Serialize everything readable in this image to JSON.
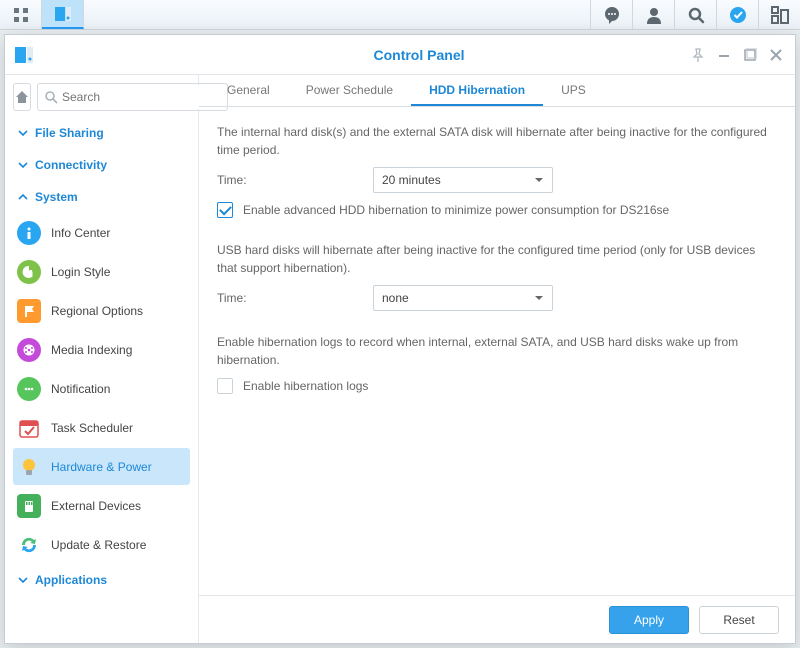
{
  "taskbar": {
    "icons_left": [
      "grid",
      "cp"
    ],
    "icons_right": [
      "chat",
      "user",
      "search",
      "check",
      "dash"
    ]
  },
  "window": {
    "title": "Control Panel",
    "search_placeholder": "Search"
  },
  "sidebar": {
    "sections": [
      {
        "label": "File Sharing",
        "open": false
      },
      {
        "label": "Connectivity",
        "open": false
      },
      {
        "label": "System",
        "open": true
      },
      {
        "label": "Applications",
        "open": false
      }
    ],
    "system_items": [
      {
        "label": "Info Center",
        "icon": "info",
        "bg": "#2aa5f0"
      },
      {
        "label": "Login Style",
        "icon": "palette",
        "bg": "#7fc24a"
      },
      {
        "label": "Regional Options",
        "icon": "flag",
        "bg": "#ff9a2e"
      },
      {
        "label": "Media Indexing",
        "icon": "film",
        "bg": "#c44bd9"
      },
      {
        "label": "Notification",
        "icon": "dots",
        "bg": "#56c55b"
      },
      {
        "label": "Task Scheduler",
        "icon": "cal",
        "bg": "#ffffff"
      },
      {
        "label": "Hardware & Power",
        "icon": "bulb",
        "bg": "#ffffff",
        "active": true
      },
      {
        "label": "External Devices",
        "icon": "sd",
        "bg": "#44b05c"
      },
      {
        "label": "Update & Restore",
        "icon": "sync",
        "bg": "#ffffff"
      }
    ]
  },
  "tabs": [
    {
      "label": "General"
    },
    {
      "label": "Power Schedule"
    },
    {
      "label": "HDD Hibernation",
      "active": true
    },
    {
      "label": "UPS"
    }
  ],
  "panel": {
    "internal_desc": "The internal hard disk(s) and the external SATA disk will hibernate after being inactive for the configured time period.",
    "time_label": "Time:",
    "internal_time_value": "20 minutes",
    "adv_label": "Enable advanced HDD hibernation to minimize power consumption for DS216se",
    "usb_desc": "USB hard disks will hibernate after being inactive for the configured time period (only for USB devices that support hibernation).",
    "usb_time_value": "none",
    "logs_desc": "Enable hibernation logs to record when internal, external SATA, and USB hard disks wake up from hibernation.",
    "logs_label": "Enable hibernation logs",
    "adv_checked": true,
    "logs_checked": false
  },
  "buttons": {
    "apply": "Apply",
    "reset": "Reset"
  }
}
